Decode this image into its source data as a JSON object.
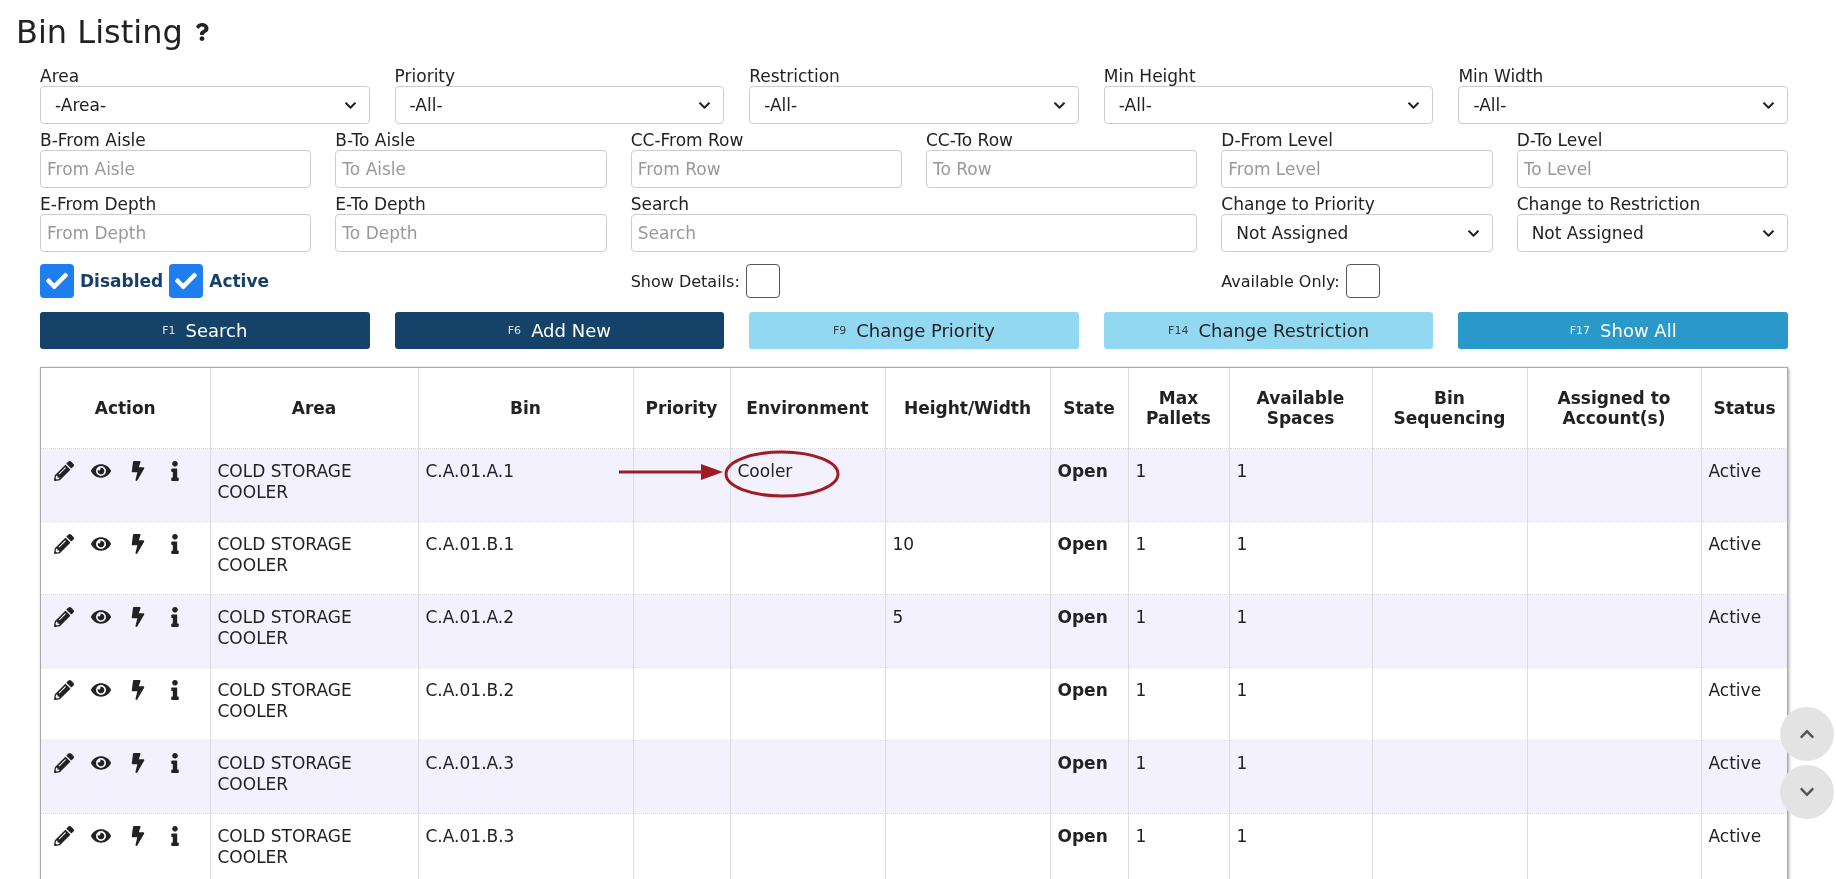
{
  "page": {
    "title": "Bin Listing"
  },
  "filter_rows": [
    [
      {
        "kind": "select",
        "label": "Area",
        "value": "-Area-"
      },
      {
        "kind": "select",
        "label": "Priority",
        "value": "-All-"
      },
      {
        "kind": "select",
        "label": "Restriction",
        "value": "-All-"
      },
      {
        "kind": "select",
        "label": "Min Height",
        "value": "-All-"
      },
      {
        "kind": "select",
        "label": "Min Width",
        "value": "-All-"
      }
    ],
    [
      {
        "kind": "input",
        "label": "B-From Aisle",
        "placeholder": "From Aisle"
      },
      {
        "kind": "input",
        "label": "B-To Aisle",
        "placeholder": "To Aisle"
      },
      {
        "kind": "input",
        "label": "CC-From Row",
        "placeholder": "From Row"
      },
      {
        "kind": "input",
        "label": "CC-To Row",
        "placeholder": "To Row"
      },
      {
        "kind": "input",
        "label": "D-From Level",
        "placeholder": "From Level"
      },
      {
        "kind": "input",
        "label": "D-To Level",
        "placeholder": "To Level"
      }
    ],
    [
      {
        "kind": "input",
        "label": "E-From Depth",
        "placeholder": "From Depth"
      },
      {
        "kind": "input",
        "label": "E-To Depth",
        "placeholder": "To Depth"
      },
      {
        "kind": "search",
        "label": "Search",
        "placeholder": "Search"
      },
      {
        "kind": "select",
        "label": "Change to Priority",
        "value": "Not Assigned"
      },
      {
        "kind": "select",
        "label": "Change to Restriction",
        "value": "Not Assigned"
      }
    ]
  ],
  "checks": [
    {
      "label": "Disabled",
      "checked": true
    },
    {
      "label": "Active",
      "checked": true
    }
  ],
  "toggles": [
    {
      "label": "Show Details:",
      "checked": false
    },
    {
      "label": "Available Only:",
      "checked": false
    }
  ],
  "buttons": [
    {
      "key": "F1",
      "label": "Search",
      "kind": "dark"
    },
    {
      "key": "F6",
      "label": "Add New",
      "kind": "dark"
    },
    {
      "key": "F9",
      "label": "Change Priority",
      "kind": "light"
    },
    {
      "key": "F14",
      "label": "Change Restriction",
      "kind": "light"
    },
    {
      "key": "F17",
      "label": "Show All",
      "kind": "info"
    }
  ],
  "table": {
    "columns": [
      {
        "label": "Action",
        "kind": "action"
      },
      {
        "label": "Area",
        "kind": "text"
      },
      {
        "label": "Bin",
        "kind": "text"
      },
      {
        "label": "Priority",
        "kind": "text"
      },
      {
        "label": "Environment",
        "kind": "text"
      },
      {
        "label": "Height/Width",
        "kind": "text"
      },
      {
        "label": "State",
        "kind": "bold"
      },
      {
        "label": "Max Pallets",
        "kind": "text"
      },
      {
        "label": "Available Spaces",
        "kind": "text"
      },
      {
        "label": "Bin Sequencing",
        "kind": "text"
      },
      {
        "label": "Assigned to Account(s)",
        "kind": "text"
      },
      {
        "label": "Status",
        "kind": "text"
      }
    ],
    "rows": [
      {
        "highlighted": true,
        "cells": [
          "",
          "COLD STORAGE COOLER",
          "C.A.01.A.1",
          "",
          "Cooler",
          "",
          "Open",
          "1",
          "1",
          "",
          "",
          "Active"
        ]
      },
      {
        "highlighted": false,
        "cells": [
          "",
          "COLD STORAGE COOLER",
          "C.A.01.B.1",
          "",
          "",
          "10",
          "Open",
          "1",
          "1",
          "",
          "",
          "Active"
        ]
      },
      {
        "highlighted": false,
        "cells": [
          "",
          "COLD STORAGE COOLER",
          "C.A.01.A.2",
          "",
          "",
          "5",
          "Open",
          "1",
          "1",
          "",
          "",
          "Active"
        ]
      },
      {
        "highlighted": false,
        "cells": [
          "",
          "COLD STORAGE COOLER",
          "C.A.01.B.2",
          "",
          "",
          "",
          "Open",
          "1",
          "1",
          "",
          "",
          "Active"
        ]
      },
      {
        "highlighted": false,
        "cells": [
          "",
          "COLD STORAGE COOLER",
          "C.A.01.A.3",
          "",
          "",
          "",
          "Open",
          "1",
          "1",
          "",
          "",
          "Active"
        ]
      },
      {
        "highlighted": false,
        "cells": [
          "",
          "COLD STORAGE COOLER",
          "C.A.01.B.3",
          "",
          "",
          "",
          "Open",
          "1",
          "1",
          "",
          "",
          "Active"
        ]
      }
    ]
  }
}
